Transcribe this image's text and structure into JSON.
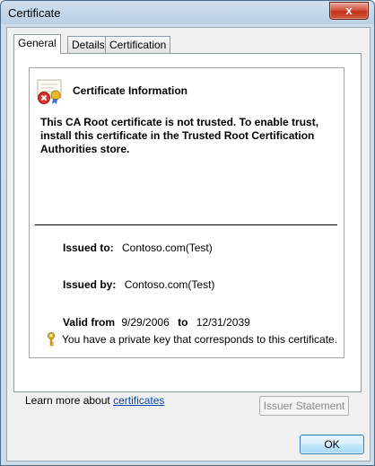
{
  "window": {
    "title": "Certificate",
    "close_label": "x"
  },
  "tabs": [
    {
      "label": "General",
      "active": true
    },
    {
      "label": "Details",
      "active": false
    },
    {
      "label": "Certification Path",
      "active": false
    }
  ],
  "cert": {
    "heading": "Certificate Information",
    "warning": "This CA Root certificate is not trusted. To enable trust, install this certificate in the Trusted Root Certification Authorities store.",
    "issued_to_label": "Issued to:",
    "issued_to_value": "Contoso.com(Test)",
    "issued_by_label": "Issued by:",
    "issued_by_value": "Contoso.com(Test)",
    "valid_from_label": "Valid from",
    "valid_from": "9/29/2006",
    "valid_to_label": "to",
    "valid_to": "12/31/2039",
    "private_key_text": "You have a private key that corresponds to this certificate."
  },
  "buttons": {
    "issuer_statement": "Issuer Statement",
    "ok": "OK"
  },
  "learn_more": {
    "prefix": "Learn more about ",
    "link": "certificates"
  },
  "colors": {
    "link": "#0a46a8",
    "close_button": "#c3301a"
  }
}
